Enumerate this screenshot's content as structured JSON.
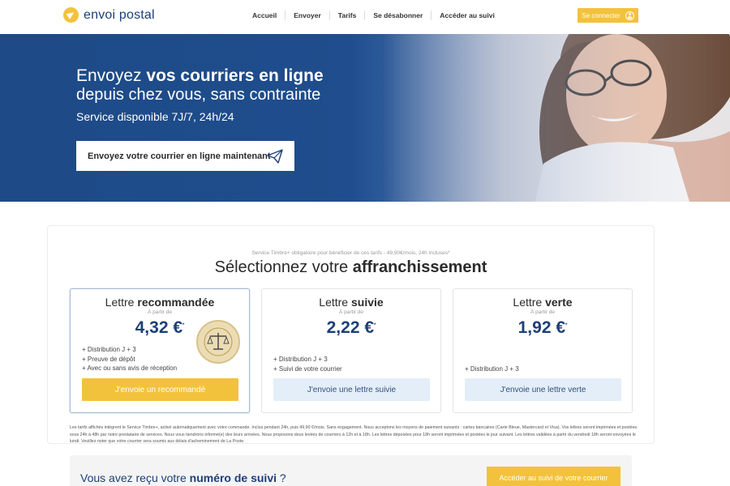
{
  "header": {
    "logo_text": "envoi postal",
    "nav": [
      "Accueil",
      "Envoyer",
      "Tarifs",
      "Se désabonner",
      "Accéder au suivi"
    ],
    "connect_label": "Se connecter"
  },
  "hero": {
    "line1_pre": "Envoyez ",
    "line1_bold": "vos courriers en ligne",
    "line2": "depuis chez vous, sans contrainte",
    "subtitle": "Service disponible 7J/7, 24h/24",
    "cta_label": "Envoyez votre courrier en ligne maintenant"
  },
  "pricing": {
    "notice": "Service Timbre+ obligatoire pour bénéficier de ces tarifs - 49,90€/mois, 24h incluses*",
    "title_pre": "Sélectionnez votre ",
    "title_bold": "affranchissement",
    "from_label": "À partir de",
    "plans": [
      {
        "name_pre": "Lettre ",
        "name_bold": "recommandée",
        "price": "4,32 €",
        "price_mark": "*",
        "features": [
          "+ Distribution J + 3",
          "+ Preuve de dépôt",
          "+ Avec ou sans avis de réception"
        ],
        "cta": "J'envoie un recommandé",
        "stamp_text": "PREUVE JURIDIQUE - PREUVE JURIDIQUE"
      },
      {
        "name_pre": "Lettre ",
        "name_bold": "suivie",
        "price": "2,22 €",
        "price_mark": "*",
        "features": [
          "+ Distribution J + 3",
          "+ Suivi de votre courrier"
        ],
        "cta": "J'envoie une lettre suivie"
      },
      {
        "name_pre": "Lettre ",
        "name_bold": "verte",
        "price": "1,92 €",
        "price_mark": "*",
        "features": [
          "+ Distribution J + 3"
        ],
        "cta": "J'envoie une lettre verte"
      }
    ]
  },
  "fineprint": "Les tarifs affichés intègrent le Service Timbre+, activé automatiquement avec votre commande. Inclus pendant 24h, puis 49,90 €/mois. Sans engagement. Nous acceptons les moyens de paiement suivants : cartes bancaires (Carte Bleue, Mastercard et Visa). Vos lettres seront imprimées et postées sous 24h à 48h par notre prestataire de services. Nous vous tiendrons informé(e) des leurs arrivées. Nous proposons deux levées de courriers à 12h et à 18h. Les lettres déposées pour 18h seront imprimées et postées le jour suivant. Les lettres validées à partir du vendredi 18h seront envoyées le lundi. Veuillez noter que votre courrier sera soumis aux délais d'acheminement de La Poste.",
  "tracking": {
    "text_pre": "Vous avez reçu votre ",
    "text_bold": "numéro de suivi",
    "text_post": " ?",
    "cta": "Accéder au suivi de votre courrier"
  },
  "colors": {
    "brand_blue": "#1d3f78",
    "accent_yellow": "#f3c23c",
    "light_blue": "#e4eef9"
  }
}
